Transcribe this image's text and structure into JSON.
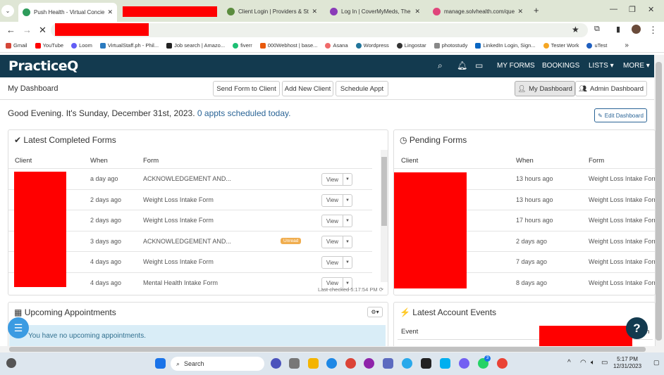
{
  "browser": {
    "tabs": [
      {
        "title": "Push Health - Virtual Concierge",
        "active": true
      },
      {
        "title": "",
        "redacted": true
      },
      {
        "title": "Client Login | Providers & Staff"
      },
      {
        "title": "Log In | CoverMyMeds, The Lea..."
      },
      {
        "title": "manage.solvhealth.com/queue"
      }
    ],
    "bookmarks": [
      "Gmail",
      "YouTube",
      "Loom",
      "VirtualStaff.ph - Phil...",
      "Job search | Amazo...",
      "fiverr",
      "000Webhost | base...",
      "Asana",
      "Wordpress",
      "Lingostar",
      "photostudy",
      "LinkedIn Login, Sign...",
      "Tester Work",
      "uTest"
    ]
  },
  "app": {
    "logo": "PracticeQ",
    "nav": {
      "my_forms": "MY FORMS",
      "bookings": "BOOKINGS",
      "lists": "LISTS ▾",
      "more": "MORE ▾"
    },
    "dashboard_title": "My Dashboard",
    "buttons": {
      "send_form": "Send Form to Client",
      "add_client": "Add New Client",
      "schedule": "Schedule Appt",
      "my_dashboard": "My Dashboard",
      "admin_dashboard": "Admin Dashboard",
      "edit_dashboard": "Edit Dashboard"
    },
    "greeting": "Good Evening. It's Sunday, December 31st, 2023.",
    "appts_link": "0 appts scheduled today."
  },
  "completed_forms": {
    "title": "Latest Completed Forms",
    "headers": {
      "client": "Client",
      "when": "When",
      "form": "Form"
    },
    "rows": [
      {
        "when": "a day ago",
        "form": "ACKNOWLEDGEMENT AND...",
        "unread": false
      },
      {
        "when": "2 days ago",
        "form": "Weight Loss Intake Form",
        "unread": false
      },
      {
        "when": "2 days ago",
        "form": "Weight Loss Intake Form",
        "unread": false
      },
      {
        "when": "3 days ago",
        "form": "ACKNOWLEDGEMENT AND...",
        "unread": true
      },
      {
        "when": "4 days ago",
        "form": "Weight Loss Intake Form",
        "unread": false
      },
      {
        "when": "4 days ago",
        "form": "Mental Health Intake Form",
        "unread": false
      }
    ],
    "view_label": "View",
    "unread_label": "Unread",
    "last_checked": "Last checked 5:17:54 PM"
  },
  "pending_forms": {
    "title": "Pending Forms",
    "headers": {
      "client": "Client",
      "when": "When",
      "form": "Form"
    },
    "rows": [
      {
        "when": "13 hours ago",
        "form": "Weight Loss Intake Form"
      },
      {
        "when": "13 hours ago",
        "form": "Weight Loss Intake Form"
      },
      {
        "when": "17 hours ago",
        "form": "Weight Loss Intake Form"
      },
      {
        "when": "2 days ago",
        "form": "Weight Loss Intake Form"
      },
      {
        "when": "7 days ago",
        "form": "Weight Loss Intake Form"
      },
      {
        "when": "8 days ago",
        "form": "Weight Loss Intake Form"
      }
    ]
  },
  "upcoming": {
    "title": "Upcoming Appointments",
    "empty": "You have no upcoming appointments."
  },
  "account_events": {
    "title": "Latest Account Events",
    "header_event": "Event",
    "header_partial": "n"
  },
  "taskbar": {
    "search": "Search",
    "time": "5:17 PM",
    "date": "12/31/2023",
    "badge": "3"
  },
  "colors": {
    "nav_bg": "#133a4f",
    "link": "#2a6496",
    "redaction": "#ff0000",
    "unread": "#f0ad4e",
    "info_bg": "#d9edf7"
  }
}
